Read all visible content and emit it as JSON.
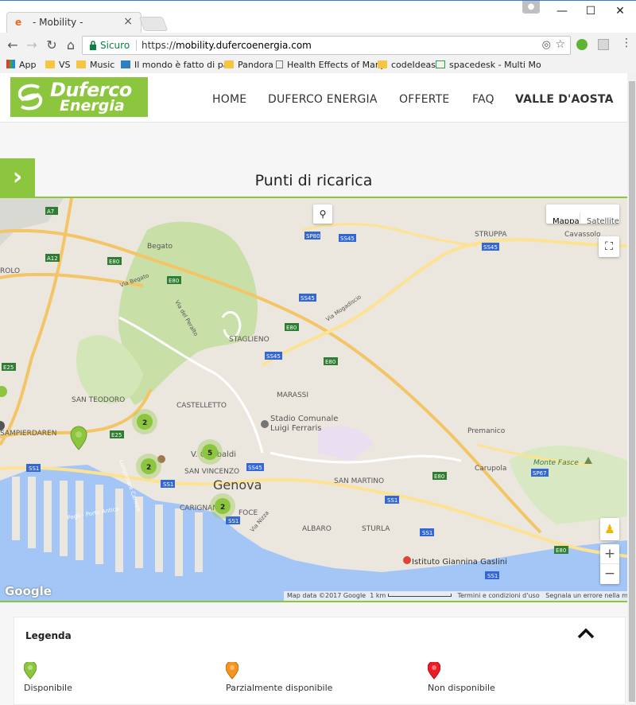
{
  "browser": {
    "tab_title": "- Mobility -",
    "secure_label": "Sicuro",
    "url_scheme": "https://",
    "url_host": "mobility.dufercoenergia.com",
    "bookmarks": [
      "App",
      "VS",
      "Music",
      "Il mondo è fatto di pa",
      "Pandora",
      "Health Effects of Marij",
      "codeIdeas",
      "spacedesk - Multi Mo"
    ]
  },
  "site": {
    "logo_line1": "Duferco",
    "logo_line2": "Energia",
    "nav": [
      "HOME",
      "DUFERCO ENERGIA",
      "OFFERTE",
      "FAQ",
      "VALLE D'AOSTA"
    ],
    "page_title": "Punti di ricarica"
  },
  "map": {
    "type_map": "Mappa",
    "type_satellite": "Satellite",
    "zoom_in": "+",
    "zoom_out": "−",
    "google": "Google",
    "attribution": "Map data ©2017 Google",
    "scale": "1 km",
    "terms": "Termini e condizioni d'uso",
    "report": "Segnala un errore nella mappa",
    "labels": {
      "begato": "Begato",
      "staglieno": "STAGLIENO",
      "marassi": "MARASSI",
      "san_teodoro": "SAN TEODORO",
      "castelletto": "CASTELLETTO",
      "sampierdarena": "SAMPIERDAREN",
      "stadio1": "Stadio Comunale",
      "stadio2": "Luigi Ferraris",
      "garibaldi": "V. Garibaldi",
      "san_vincenzo": "SAN VINCENZO",
      "genova": "Genova",
      "san_martino": "SAN MARTINO",
      "carignano": "CARIGNANO",
      "foce": "FOCE",
      "albaro": "ALBARO",
      "sturla": "STURLA",
      "gaslini": "Istituto Giannina Gaslini",
      "struppa": "STRUPPA",
      "cavassolo": "Cavassolo",
      "premanico": "Premanico",
      "carupola": "Carupola",
      "monte_fasce": "Monte Fasce",
      "rolo": "ROLO",
      "via_begato": "Via Begato",
      "via_peralto": "Via del Peralto",
      "via_mogadiscio": "Via Mogadiscio",
      "via_nizza": "Via Nizza",
      "pegli": "Pegli - Porto Antico",
      "lungomare": "Lungomare Canepa"
    },
    "roads": [
      "A7",
      "A12",
      "E80",
      "E25",
      "SP80",
      "SS45",
      "SS1",
      "SP67"
    ],
    "clusters": [
      {
        "count": "2"
      },
      {
        "count": "2"
      },
      {
        "count": "5"
      },
      {
        "count": "2"
      }
    ]
  },
  "legend": {
    "title": "Legenda",
    "items": [
      {
        "label": "Disponibile",
        "color": "#8cc63f"
      },
      {
        "label": "Parzialmente disponibile",
        "color": "#f7941d"
      },
      {
        "label": "Non disponibile",
        "color": "#ed1c24"
      }
    ]
  },
  "colors": {
    "brand": "#8cc63f",
    "water": "#a3c6f7",
    "park": "#c8dfa8",
    "highway": "#f3c566"
  }
}
